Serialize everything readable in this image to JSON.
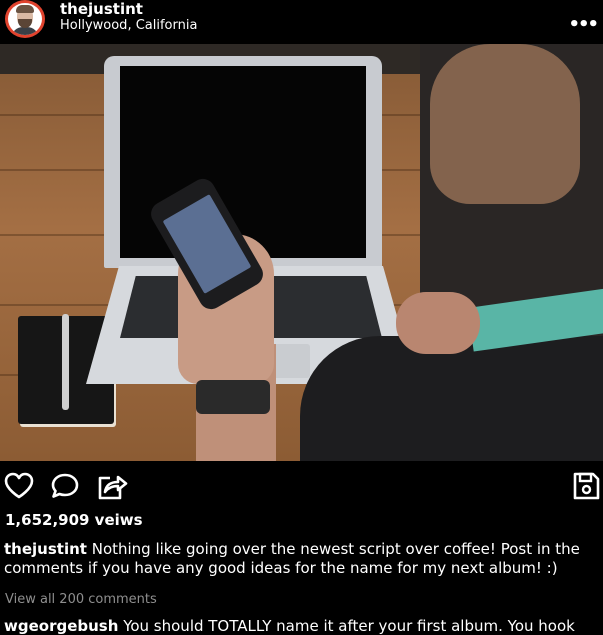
{
  "post": {
    "username": "thejustint",
    "location": "Hollywood, California",
    "more_label": "•••",
    "views": "1,652,909 veiws",
    "caption": {
      "username": "thejustint",
      "text": "Nothing like going over the newest script over coffee! Post in the comments if you have any good ideas for the name for my next album! :)"
    },
    "view_all_comments": "View all 200 comments",
    "comment": {
      "username": "wgeorgebush",
      "text": "You should TOTALLY name it after your first album. You hook"
    }
  },
  "icons": {
    "like": "heart-icon",
    "comment": "speech-bubble-icon",
    "share": "share-arrow-icon",
    "save": "floppy-disk-icon",
    "more": "ellipsis-icon"
  },
  "colors": {
    "background": "#000000",
    "text": "#ffffff",
    "muted": "#8e8e8e",
    "avatar_ring": "#e0432e"
  }
}
